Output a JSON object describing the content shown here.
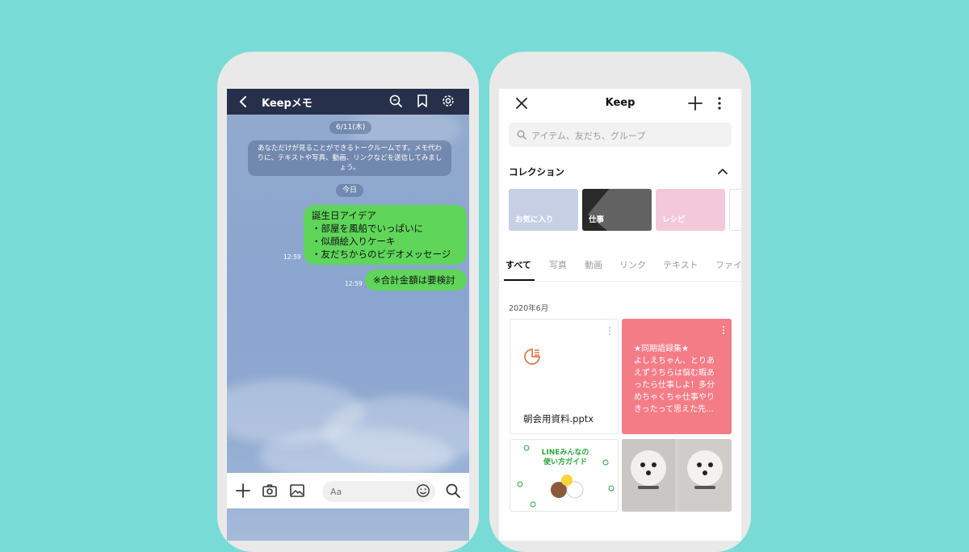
{
  "chat": {
    "header_title": "Keepメモ",
    "date_pill": "6/11(木)",
    "system_message": "あなただけが見ることができるトークルームです。メモ代わりに、テキストや写真、動画、リンクなどを送信してみましょう。",
    "today_pill": "今日",
    "message1_lines": [
      "誕生日アイデア",
      "・部屋を風船でいっぱいに",
      "・似顔絵入りケーキ",
      "・友だちからのビデオメッセージ"
    ],
    "message1_time": "12:59",
    "message2": "※合計金額は要検討",
    "message2_time": "12:59",
    "input_placeholder": "Aa"
  },
  "keep": {
    "header_title": "Keep",
    "search_placeholder": "アイテム、友だち、グループ",
    "collection_label": "コレクション",
    "collections": [
      {
        "label": "お気に入り",
        "color": "#c7cfe4"
      },
      {
        "label": "仕事",
        "color": "#2a2a2a"
      },
      {
        "label": "レシピ",
        "color": "#f3c9da"
      }
    ],
    "tabs": [
      "すべて",
      "写真",
      "動画",
      "リンク",
      "テキスト",
      "ファイ"
    ],
    "month_label": "2020年6月",
    "file_name": "朝会用資料.pptx",
    "note_lines": [
      "★同期語録集★",
      "よしえちゃん、とりあ",
      "えずうちらは悩む暇あ",
      "ったら仕事しよ！多分",
      "めちゃくちゃ仕事やり",
      "きったって思えた先..."
    ],
    "guide_title_lines": [
      "LINEみんなの",
      "使い方ガイド"
    ]
  },
  "colors": {
    "background": "#79dbd6",
    "chat_header": "#27304a",
    "bubble_green": "#5fd65a",
    "note_pink": "#f47c86"
  }
}
